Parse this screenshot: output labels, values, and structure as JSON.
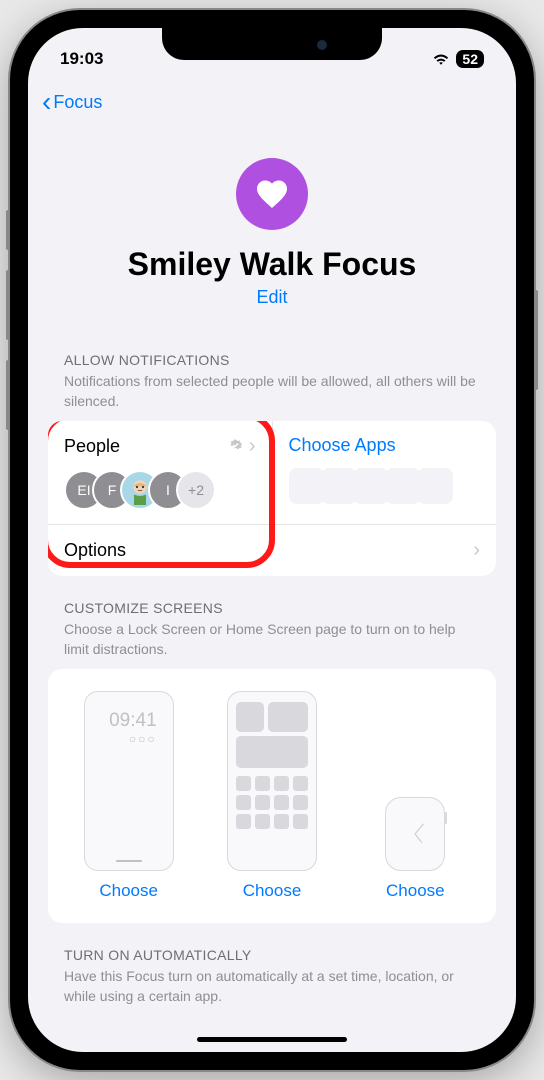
{
  "statusBar": {
    "time": "19:03",
    "battery": "52"
  },
  "nav": {
    "back": "Focus"
  },
  "hero": {
    "title": "Smiley Walk Focus",
    "edit": "Edit"
  },
  "allowNotifications": {
    "header": "ALLOW NOTIFICATIONS",
    "desc": "Notifications from selected people will be allowed, all others will be silenced.",
    "peopleTitle": "People",
    "appsTitle": "Choose Apps",
    "avatars": [
      "EI",
      "F",
      "",
      "I"
    ],
    "more": "+2",
    "options": "Options"
  },
  "customizeScreens": {
    "header": "CUSTOMIZE SCREENS",
    "desc": "Choose a Lock Screen or Home Screen page to turn on to help limit distractions.",
    "lockTime": "09:41",
    "choose": "Choose"
  },
  "autoSection": {
    "header": "TURN ON AUTOMATICALLY",
    "desc": "Have this Focus turn on automatically at a set time, location, or while using a certain app."
  }
}
